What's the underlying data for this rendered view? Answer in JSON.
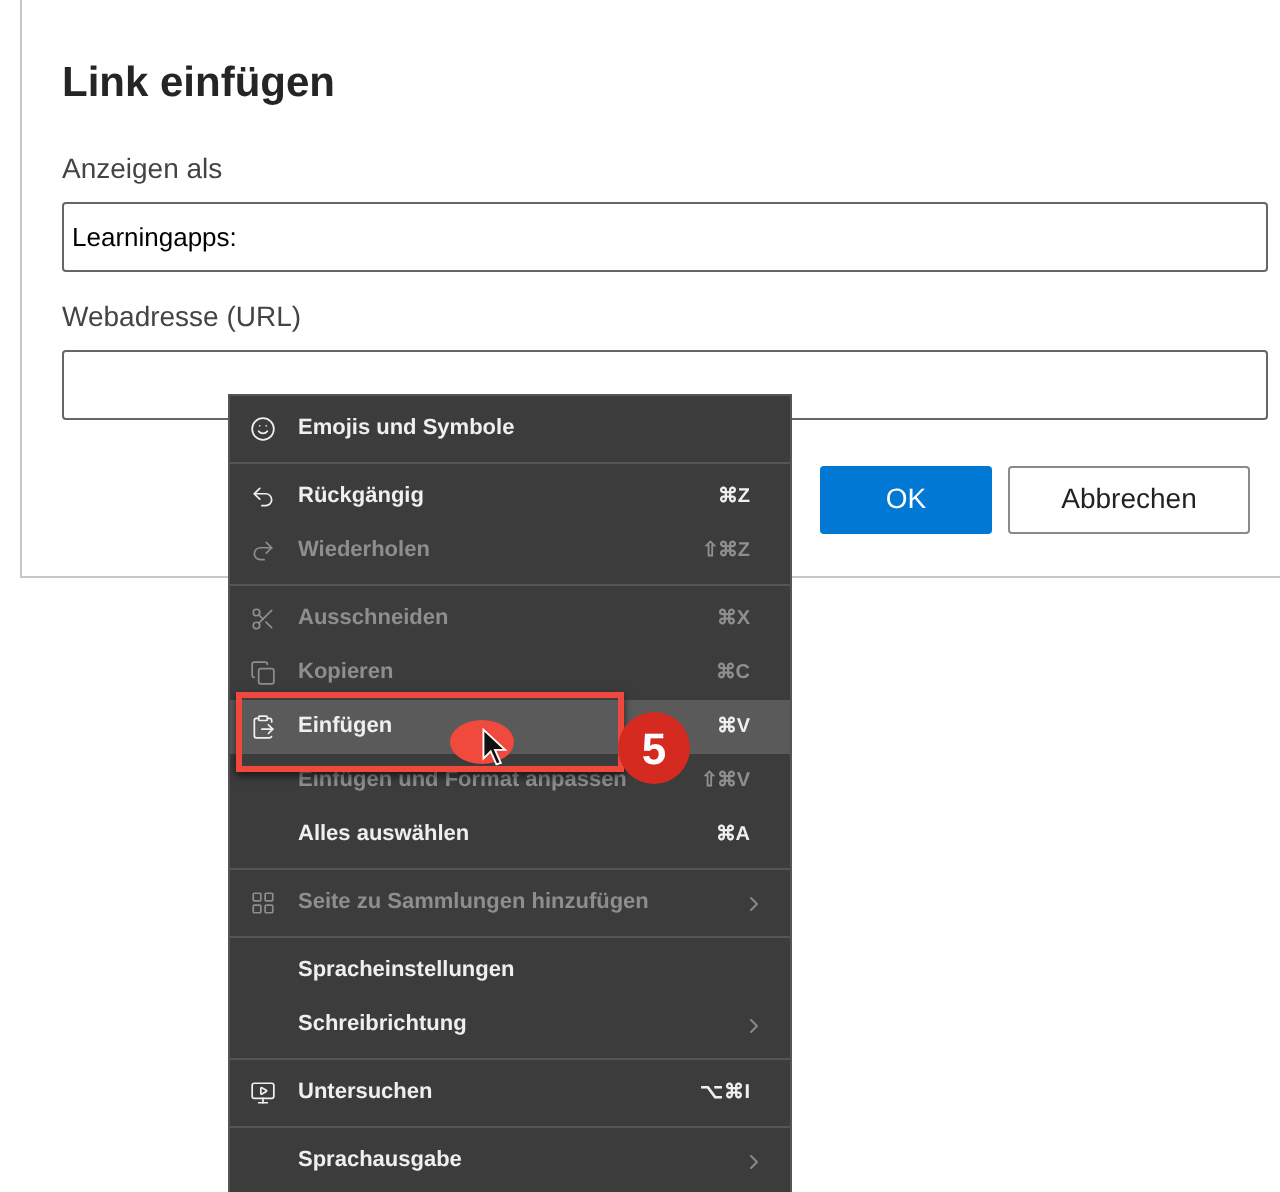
{
  "dialog": {
    "title": "Link einfügen",
    "fields": [
      {
        "label": "Anzeigen als",
        "value": "Learningapps:"
      },
      {
        "label": "Webadresse (URL)"
      }
    ],
    "buttons": [
      {
        "label": "OK",
        "kind": "primary"
      },
      {
        "label": "Abbrechen",
        "kind": "secondary"
      }
    ]
  },
  "context_menu": {
    "items": [
      {
        "kind": "item",
        "label": "Emojis und Symbole",
        "disabled": false,
        "selected": false,
        "submenu": false
      },
      {
        "kind": "separator"
      },
      {
        "kind": "item",
        "label": "Rückgängig",
        "shortcut": "⌘Z",
        "disabled": false,
        "selected": false,
        "submenu": false
      },
      {
        "kind": "item",
        "label": "Wiederholen",
        "shortcut": "⇧⌘Z",
        "disabled": true,
        "selected": false,
        "submenu": false
      },
      {
        "kind": "separator"
      },
      {
        "kind": "item",
        "label": "Ausschneiden",
        "shortcut": "⌘X",
        "disabled": true,
        "selected": false,
        "submenu": false
      },
      {
        "kind": "item",
        "label": "Kopieren",
        "shortcut": "⌘C",
        "disabled": true,
        "selected": false,
        "submenu": false
      },
      {
        "kind": "item",
        "label": "Einfügen",
        "shortcut": "⌘V",
        "disabled": false,
        "selected": true,
        "submenu": false
      },
      {
        "kind": "item",
        "label": "Einfügen und Format anpassen",
        "shortcut": "⇧⌘V",
        "disabled": true,
        "selected": false,
        "submenu": false
      },
      {
        "kind": "item",
        "label": "Alles auswählen",
        "shortcut": "⌘A",
        "disabled": false,
        "selected": false,
        "submenu": false
      },
      {
        "kind": "separator"
      },
      {
        "kind": "item",
        "label": "Seite zu Sammlungen hinzufügen",
        "disabled": true,
        "selected": false,
        "submenu": true
      },
      {
        "kind": "separator"
      },
      {
        "kind": "item",
        "label": "Spracheinstellungen",
        "disabled": false,
        "selected": false,
        "submenu": false
      },
      {
        "kind": "item",
        "label": "Schreibrichtung",
        "disabled": false,
        "selected": false,
        "submenu": true
      },
      {
        "kind": "separator"
      },
      {
        "kind": "item",
        "label": "Untersuchen",
        "shortcut": "⌥⌘I",
        "disabled": false,
        "selected": false,
        "submenu": false
      },
      {
        "kind": "separator"
      },
      {
        "kind": "item",
        "label": "Sprachausgabe",
        "disabled": false,
        "selected": false,
        "submenu": true
      }
    ]
  },
  "annotation": {
    "step": "5"
  }
}
